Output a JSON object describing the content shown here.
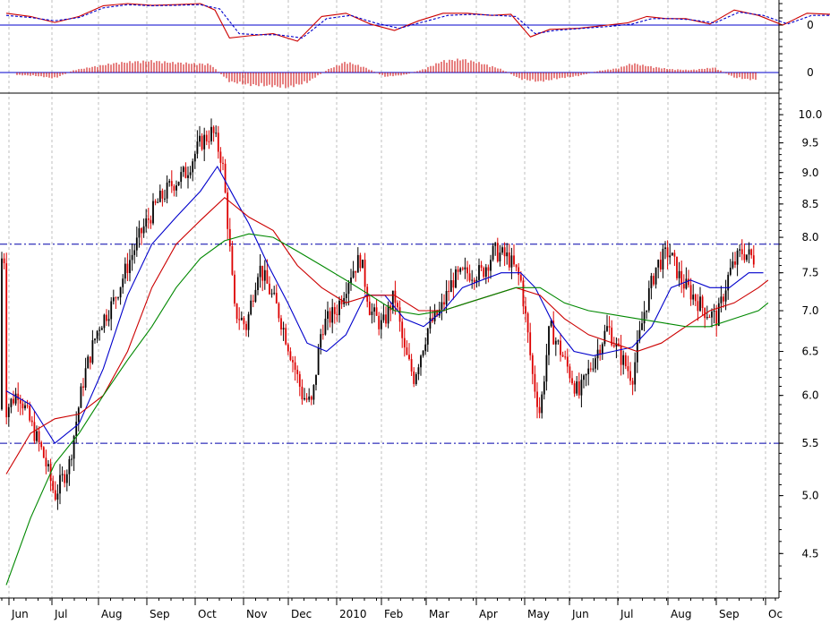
{
  "chart_data": [
    {
      "type": "line",
      "panel": "oscillator",
      "series": [
        {
          "color": "#cc0000",
          "style": "solid",
          "values": [
            [
              0,
              0.55
            ],
            [
              0.5,
              0.4
            ],
            [
              1.0,
              0.12
            ],
            [
              1.5,
              0.4
            ],
            [
              2.0,
              0.9
            ],
            [
              2.5,
              1.0
            ],
            [
              3.0,
              0.92
            ],
            [
              3.5,
              0.95
            ],
            [
              4.0,
              1.0
            ],
            [
              4.3,
              0.7
            ],
            [
              4.6,
              -0.6
            ],
            [
              5.0,
              -0.5
            ],
            [
              5.5,
              -0.4
            ],
            [
              6.0,
              -0.75
            ],
            [
              6.5,
              0.4
            ],
            [
              7.0,
              0.55
            ],
            [
              7.5,
              0.05
            ],
            [
              8.0,
              -0.25
            ],
            [
              8.5,
              0.2
            ],
            [
              9.0,
              0.55
            ],
            [
              9.5,
              0.55
            ],
            [
              10.0,
              0.45
            ],
            [
              10.4,
              0.5
            ],
            [
              10.8,
              -0.55
            ],
            [
              11.2,
              -0.2
            ],
            [
              11.8,
              -0.15
            ],
            [
              12.4,
              0.0
            ],
            [
              12.8,
              0.1
            ],
            [
              13.2,
              0.4
            ],
            [
              13.6,
              0.3
            ],
            [
              14.0,
              0.3
            ],
            [
              14.5,
              0.05
            ],
            [
              15.0,
              0.7
            ],
            [
              15.5,
              0.45
            ],
            [
              16.0,
              0.0
            ],
            [
              16.5,
              0.55
            ],
            [
              17.0,
              0.5
            ],
            [
              17.5,
              0.45
            ]
          ]
        },
        {
          "color": "#0000cc",
          "style": "dashed",
          "values": [
            [
              0,
              0.45
            ],
            [
              0.5,
              0.35
            ],
            [
              1.0,
              0.2
            ],
            [
              1.5,
              0.35
            ],
            [
              2.0,
              0.8
            ],
            [
              2.5,
              0.95
            ],
            [
              3.0,
              0.9
            ],
            [
              3.5,
              0.92
            ],
            [
              4.0,
              0.95
            ],
            [
              4.4,
              0.75
            ],
            [
              4.8,
              -0.4
            ],
            [
              5.2,
              -0.45
            ],
            [
              5.6,
              -0.45
            ],
            [
              6.1,
              -0.6
            ],
            [
              6.6,
              0.3
            ],
            [
              7.1,
              0.45
            ],
            [
              7.6,
              0.1
            ],
            [
              8.1,
              -0.15
            ],
            [
              8.6,
              0.15
            ],
            [
              9.1,
              0.45
            ],
            [
              9.6,
              0.5
            ],
            [
              10.1,
              0.45
            ],
            [
              10.5,
              0.4
            ],
            [
              10.9,
              -0.4
            ],
            [
              11.3,
              -0.25
            ],
            [
              11.9,
              -0.15
            ],
            [
              12.5,
              -0.05
            ],
            [
              12.9,
              0.05
            ],
            [
              13.3,
              0.3
            ],
            [
              13.7,
              0.3
            ],
            [
              14.1,
              0.25
            ],
            [
              14.6,
              0.1
            ],
            [
              15.1,
              0.6
            ],
            [
              15.6,
              0.45
            ],
            [
              16.1,
              0.05
            ],
            [
              16.6,
              0.45
            ],
            [
              17.1,
              0.45
            ],
            [
              17.5,
              0.4
            ]
          ]
        }
      ],
      "y_ticks": [
        "0"
      ],
      "zero_line": 0
    },
    {
      "type": "bar",
      "panel": "histogram",
      "color": "#cc0000",
      "values": [
        [
          0.2,
          -0.15
        ],
        [
          0.6,
          -0.2
        ],
        [
          1.0,
          -0.35
        ],
        [
          1.4,
          0.15
        ],
        [
          1.8,
          0.35
        ],
        [
          2.2,
          0.55
        ],
        [
          2.6,
          0.65
        ],
        [
          3.0,
          0.7
        ],
        [
          3.4,
          0.6
        ],
        [
          3.8,
          0.55
        ],
        [
          4.2,
          0.5
        ],
        [
          4.6,
          -0.55
        ],
        [
          5.0,
          -0.75
        ],
        [
          5.4,
          -0.8
        ],
        [
          5.8,
          -0.9
        ],
        [
          6.2,
          -0.6
        ],
        [
          6.6,
          0.15
        ],
        [
          7.0,
          0.65
        ],
        [
          7.4,
          0.3
        ],
        [
          7.8,
          -0.25
        ],
        [
          8.2,
          -0.15
        ],
        [
          8.6,
          0.2
        ],
        [
          9.0,
          0.7
        ],
        [
          9.4,
          0.8
        ],
        [
          9.8,
          0.55
        ],
        [
          10.2,
          0.2
        ],
        [
          10.6,
          -0.4
        ],
        [
          11.0,
          -0.55
        ],
        [
          11.4,
          -0.35
        ],
        [
          11.8,
          -0.2
        ],
        [
          12.2,
          0.1
        ],
        [
          12.6,
          0.25
        ],
        [
          12.9,
          0.55
        ],
        [
          13.3,
          0.35
        ],
        [
          13.7,
          0.2
        ],
        [
          14.1,
          0.15
        ],
        [
          14.6,
          0.3
        ],
        [
          15.0,
          -0.3
        ],
        [
          15.4,
          -0.45
        ],
        [
          15.8,
          -0.25
        ],
        [
          16.2,
          0.3
        ],
        [
          16.6,
          0.25
        ],
        [
          17.0,
          0.2
        ],
        [
          17.4,
          0.1
        ]
      ],
      "y_ticks": [
        "0"
      ],
      "zero_line": 0
    },
    {
      "type": "candlestick",
      "panel": "price",
      "scale": "log",
      "ylim": [
        4.15,
        10.4
      ],
      "y_ticks": [
        "10.0",
        "9.5",
        "9.0",
        "8.5",
        "8.0",
        "7.5",
        "7.0",
        "6.5",
        "6.0",
        "5.5",
        "5.0",
        "4.5"
      ],
      "x_ticks": [
        "Jun",
        "Jul",
        "Aug",
        "Sep",
        "Oct",
        "Nov",
        "Dec",
        "2010",
        "Feb",
        "Mar",
        "Apr",
        "May",
        "Jun",
        "Jul",
        "Aug",
        "Sep",
        "Oc"
      ],
      "horizontal_lines": [
        7.9,
        5.5
      ],
      "up_color": "#000000",
      "down_color": "#dd0000",
      "price_path": [
        [
          0,
          5.85
        ],
        [
          0.25,
          6.05
        ],
        [
          0.5,
          5.7
        ],
        [
          0.75,
          5.4
        ],
        [
          1.0,
          5.0
        ],
        [
          1.3,
          5.3
        ],
        [
          1.6,
          6.2
        ],
        [
          1.9,
          6.8
        ],
        [
          2.2,
          7.1
        ],
        [
          2.5,
          7.6
        ],
        [
          2.8,
          8.1
        ],
        [
          3.1,
          8.5
        ],
        [
          3.4,
          8.8
        ],
        [
          3.7,
          9.0
        ],
        [
          4.0,
          9.5
        ],
        [
          4.25,
          9.7
        ],
        [
          4.45,
          9.2
        ],
        [
          4.7,
          7.0
        ],
        [
          4.95,
          6.8
        ],
        [
          5.2,
          7.6
        ],
        [
          5.4,
          7.3
        ],
        [
          5.6,
          7.0
        ],
        [
          5.85,
          6.5
        ],
        [
          6.1,
          6.0
        ],
        [
          6.3,
          5.9
        ],
        [
          6.5,
          6.8
        ],
        [
          6.8,
          7.0
        ],
        [
          7.1,
          7.5
        ],
        [
          7.3,
          7.7
        ],
        [
          7.5,
          7.0
        ],
        [
          7.75,
          6.8
        ],
        [
          8.0,
          7.2
        ],
        [
          8.2,
          6.5
        ],
        [
          8.4,
          6.2
        ],
        [
          8.7,
          6.8
        ],
        [
          8.95,
          7.0
        ],
        [
          9.2,
          7.4
        ],
        [
          9.5,
          7.5
        ],
        [
          9.8,
          7.5
        ],
        [
          10.05,
          7.8
        ],
        [
          10.35,
          7.7
        ],
        [
          10.6,
          7.4
        ],
        [
          10.85,
          6.2
        ],
        [
          11.0,
          5.8
        ],
        [
          11.2,
          6.8
        ],
        [
          11.5,
          6.4
        ],
        [
          11.8,
          6.0
        ],
        [
          12.1,
          6.4
        ],
        [
          12.4,
          6.8
        ],
        [
          12.6,
          6.5
        ],
        [
          12.9,
          6.2
        ],
        [
          13.15,
          7.0
        ],
        [
          13.4,
          7.6
        ],
        [
          13.65,
          7.8
        ],
        [
          13.9,
          7.4
        ],
        [
          14.15,
          7.2
        ],
        [
          14.4,
          7.0
        ],
        [
          14.65,
          6.9
        ],
        [
          14.9,
          7.5
        ],
        [
          15.15,
          7.8
        ],
        [
          15.4,
          7.7
        ],
        [
          15.6,
          7.8
        ],
        [
          15.75,
          7.7
        ]
      ],
      "moving_averages": [
        {
          "color": "#0000cc",
          "values": [
            [
              0,
              6.05
            ],
            [
              0.5,
              5.9
            ],
            [
              1.0,
              5.5
            ],
            [
              1.5,
              5.7
            ],
            [
              2.0,
              6.3
            ],
            [
              2.5,
              7.2
            ],
            [
              3.0,
              7.9
            ],
            [
              3.5,
              8.3
            ],
            [
              4.0,
              8.7
            ],
            [
              4.35,
              9.1
            ],
            [
              4.7,
              8.6
            ],
            [
              5.0,
              8.2
            ],
            [
              5.4,
              7.6
            ],
            [
              5.8,
              7.1
            ],
            [
              6.2,
              6.6
            ],
            [
              6.6,
              6.5
            ],
            [
              7.0,
              6.7
            ],
            [
              7.4,
              7.2
            ],
            [
              7.8,
              7.2
            ],
            [
              8.2,
              6.9
            ],
            [
              8.6,
              6.8
            ],
            [
              9.0,
              7.0
            ],
            [
              9.4,
              7.3
            ],
            [
              9.8,
              7.4
            ],
            [
              10.2,
              7.5
            ],
            [
              10.6,
              7.5
            ],
            [
              10.9,
              7.3
            ],
            [
              11.3,
              6.8
            ],
            [
              11.7,
              6.5
            ],
            [
              12.1,
              6.45
            ],
            [
              12.5,
              6.5
            ],
            [
              12.9,
              6.55
            ],
            [
              13.3,
              6.8
            ],
            [
              13.7,
              7.3
            ],
            [
              14.1,
              7.4
            ],
            [
              14.5,
              7.3
            ],
            [
              14.9,
              7.3
            ],
            [
              15.3,
              7.5
            ],
            [
              15.6,
              7.5
            ]
          ]
        },
        {
          "color": "#cc0000",
          "values": [
            [
              0,
              5.2
            ],
            [
              0.5,
              5.6
            ],
            [
              1.0,
              5.75
            ],
            [
              1.5,
              5.8
            ],
            [
              2.0,
              6.0
            ],
            [
              2.5,
              6.5
            ],
            [
              3.0,
              7.3
            ],
            [
              3.5,
              7.9
            ],
            [
              4.0,
              8.25
            ],
            [
              4.5,
              8.6
            ],
            [
              5.0,
              8.3
            ],
            [
              5.5,
              8.1
            ],
            [
              6.0,
              7.6
            ],
            [
              6.5,
              7.3
            ],
            [
              7.0,
              7.1
            ],
            [
              7.5,
              7.2
            ],
            [
              8.0,
              7.2
            ],
            [
              8.5,
              7.0
            ],
            [
              9.0,
              7.0
            ],
            [
              9.5,
              7.1
            ],
            [
              10.0,
              7.2
            ],
            [
              10.5,
              7.3
            ],
            [
              11.0,
              7.2
            ],
            [
              11.5,
              6.9
            ],
            [
              12.0,
              6.7
            ],
            [
              12.5,
              6.6
            ],
            [
              13.0,
              6.5
            ],
            [
              13.5,
              6.6
            ],
            [
              14.0,
              6.8
            ],
            [
              14.5,
              7.0
            ],
            [
              15.0,
              7.1
            ],
            [
              15.5,
              7.3
            ],
            [
              15.7,
              7.4
            ]
          ]
        },
        {
          "color": "#008800",
          "values": [
            [
              0,
              4.25
            ],
            [
              0.5,
              4.8
            ],
            [
              1.0,
              5.3
            ],
            [
              1.5,
              5.6
            ],
            [
              2.0,
              6.0
            ],
            [
              2.5,
              6.4
            ],
            [
              3.0,
              6.8
            ],
            [
              3.5,
              7.3
            ],
            [
              4.0,
              7.7
            ],
            [
              4.5,
              7.95
            ],
            [
              5.0,
              8.05
            ],
            [
              5.5,
              8.0
            ],
            [
              6.0,
              7.8
            ],
            [
              6.5,
              7.6
            ],
            [
              7.0,
              7.4
            ],
            [
              7.5,
              7.2
            ],
            [
              8.0,
              7.0
            ],
            [
              8.5,
              6.95
            ],
            [
              9.0,
              7.0
            ],
            [
              9.5,
              7.1
            ],
            [
              10.0,
              7.2
            ],
            [
              10.5,
              7.3
            ],
            [
              11.0,
              7.3
            ],
            [
              11.5,
              7.1
            ],
            [
              12.0,
              7.0
            ],
            [
              12.5,
              6.95
            ],
            [
              13.0,
              6.9
            ],
            [
              13.5,
              6.85
            ],
            [
              14.0,
              6.8
            ],
            [
              14.5,
              6.8
            ],
            [
              15.0,
              6.9
            ],
            [
              15.5,
              7.0
            ],
            [
              15.7,
              7.1
            ]
          ]
        }
      ]
    }
  ]
}
